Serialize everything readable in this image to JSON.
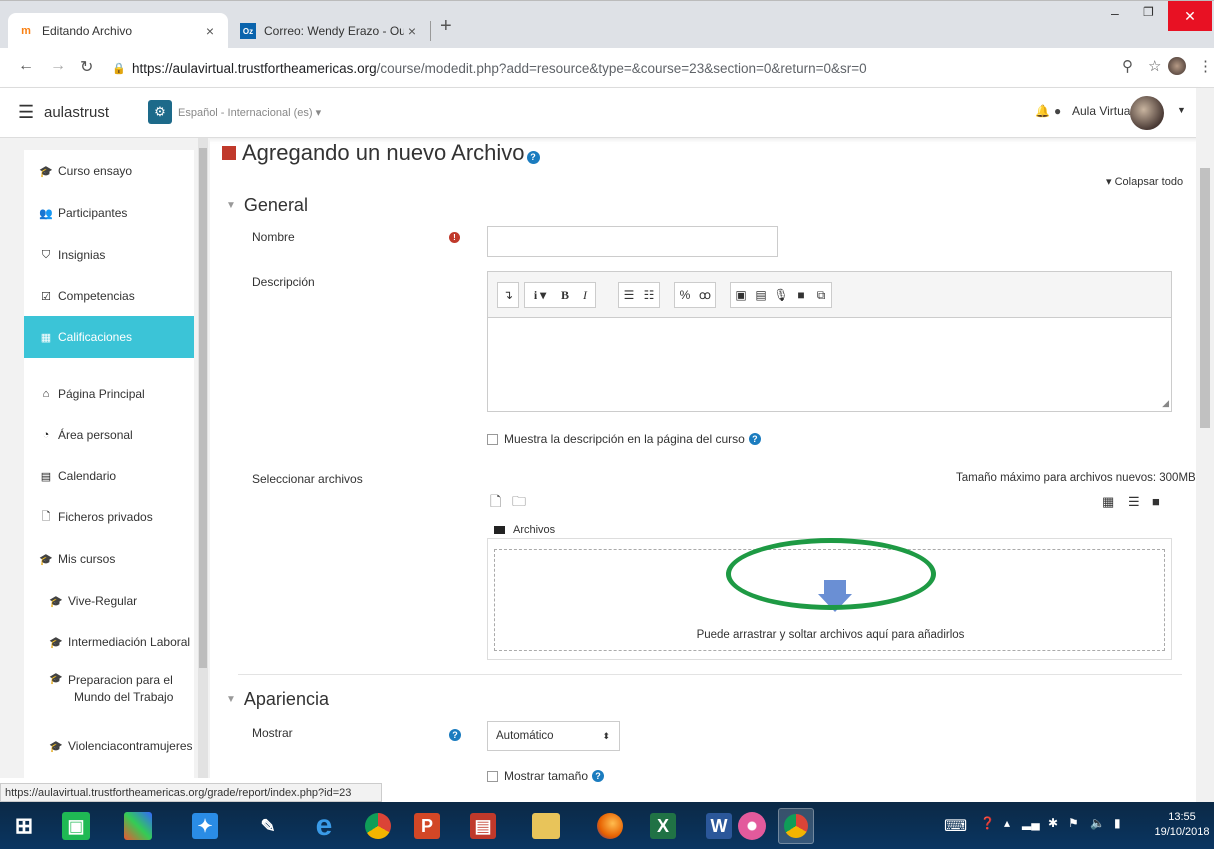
{
  "browser": {
    "tabs": [
      {
        "title": "Editando Archivo",
        "icon": "moodle-icon",
        "active": true
      },
      {
        "title": "Correo: Wendy Erazo - Outlook",
        "icon": "outlook-icon",
        "active": false
      }
    ],
    "url_host": "https://aulavirtual.trustfortheamericas.org",
    "url_path": "/course/modedit.php?add=resource&type=&course=23&section=0&return=0&sr=0"
  },
  "navbar": {
    "site_name": "aulastrust",
    "language": "Español - Internacional (es) ▾",
    "user_name": "Aula Virtual"
  },
  "sidebar": {
    "course_items": [
      {
        "label": "Curso ensayo",
        "icon": "graduation-cap-icon"
      },
      {
        "label": "Participantes",
        "icon": "users-icon"
      },
      {
        "label": "Insignias",
        "icon": "shield-icon"
      },
      {
        "label": "Competencias",
        "icon": "checkbox-icon"
      },
      {
        "label": "Calificaciones",
        "icon": "table-icon",
        "active": true
      }
    ],
    "site_items": [
      {
        "label": "Página Principal",
        "icon": "home-icon"
      },
      {
        "label": "Área personal",
        "icon": "tachometer-icon"
      },
      {
        "label": "Calendario",
        "icon": "calendar-icon"
      },
      {
        "label": "Ficheros privados",
        "icon": "file-icon"
      },
      {
        "label": "Mis cursos",
        "icon": "graduation-cap-icon"
      },
      {
        "label": "Vive-Regular",
        "icon": "graduation-cap-icon"
      },
      {
        "label": "Intermediación Laboral",
        "icon": "graduation-cap-icon"
      },
      {
        "label": "Preparacion para el",
        "label2": "Mundo del Trabajo",
        "icon": "graduation-cap-icon"
      },
      {
        "label": "Violenciacontramujeres",
        "icon": "graduation-cap-icon"
      }
    ]
  },
  "main": {
    "page_title": "Agregando un nuevo Archivo",
    "collapse_all": "▾ Colapsar todo",
    "section_general": "General",
    "nombre_label": "Nombre",
    "nombre_value": "",
    "descripcion_label": "Descripción",
    "show_description_label": "Muestra la descripción en la página del curso",
    "select_files_label": "Seleccionar archivos",
    "max_size_text": "Tamaño máximo para archivos nuevos: 300MB",
    "folder_label": "Archivos",
    "drop_text": "Puede arrastrar y soltar archivos aquí para añadirlos",
    "section_appearance": "Apariencia",
    "mostrar_label": "Mostrar",
    "mostrar_value": "Automático",
    "show_size_label": "Mostrar tamaño"
  },
  "statusbar": {
    "url": "https://aulavirtual.trustfortheamericas.org/grade/report/index.php?id=23"
  },
  "taskbar": {
    "time": "13:55",
    "date": "19/10/2018"
  },
  "colors": {
    "active_sidebar": "#3bc4d7",
    "highlight_circle": "#1e9a44",
    "required": "#c0392b",
    "help": "#1b7cbf"
  }
}
